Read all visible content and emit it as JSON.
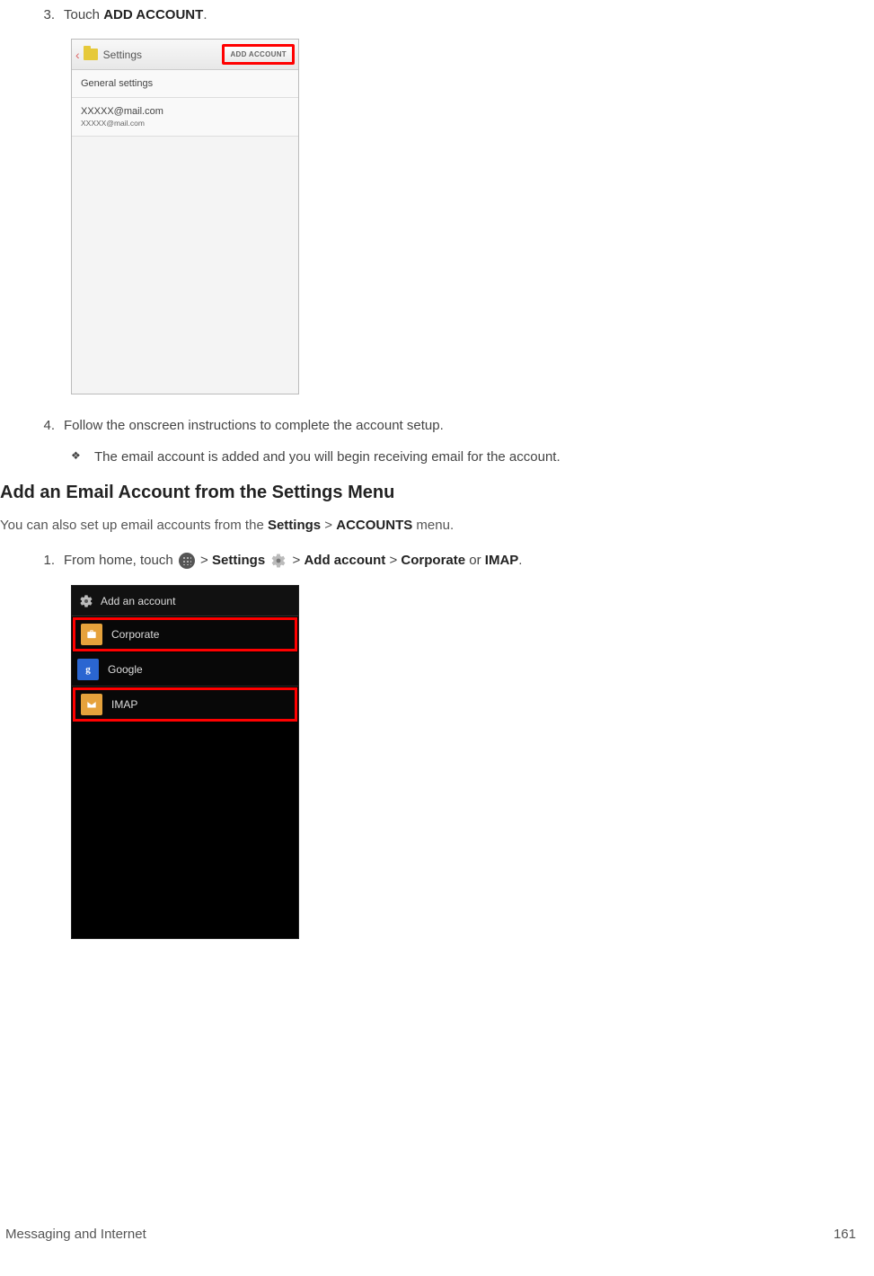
{
  "step3": {
    "num": "3.",
    "prefix": "Touch ",
    "bold": "ADD ACCOUNT",
    "suffix": "."
  },
  "shot1": {
    "title": "Settings",
    "addButton": "ADD ACCOUNT",
    "row1": "General settings",
    "row2": "XXXXX@mail.com",
    "row3": "XXXXX@mail.com"
  },
  "step4": {
    "num": "4.",
    "text": "Follow the onscreen instructions to complete the account setup."
  },
  "bullet1": {
    "text": "The email account is added and you will begin receiving email for the account."
  },
  "heading": "Add an Email Account from the Settings Menu",
  "intro": {
    "p1": "You can also set up email accounts from the ",
    "b1": "Settings",
    "gt1": " > ",
    "b2": "ACCOUNTS",
    "p2": " menu."
  },
  "step1b": {
    "num": "1.",
    "p1": "From home, touch ",
    "gt1": " > ",
    "b1": "Settings",
    "gt2": " > ",
    "b2": "Add account",
    "gt3": " > ",
    "b3": "Corporate",
    "or": " or ",
    "b4": "IMAP",
    "suffix": "."
  },
  "shot2": {
    "header": "Add an account",
    "row1": "Corporate",
    "row2": "Google",
    "googleG": "g",
    "row3": "IMAP"
  },
  "footer": {
    "left": "Messaging and Internet",
    "right": "161"
  }
}
